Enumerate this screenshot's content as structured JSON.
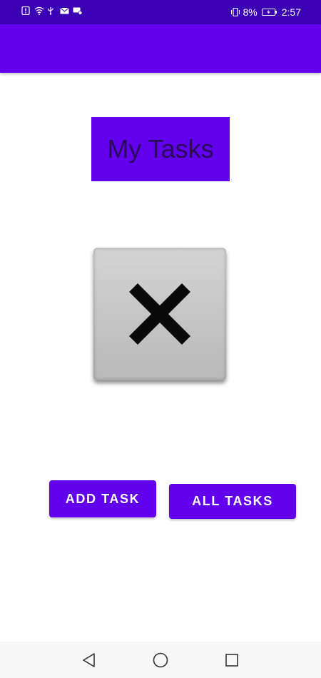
{
  "status_bar": {
    "battery_percent": "8%",
    "time": "2:57",
    "icons": [
      "alert-icon",
      "wifi-icon",
      "usb-icon",
      "mail-icon",
      "message-icon",
      "vibrate-icon",
      "battery-charging-icon"
    ]
  },
  "main": {
    "title": "My Tasks",
    "image_icon": "close-icon"
  },
  "buttons": {
    "add_task": "ADD TASK",
    "all_tasks": "ALL TASKS"
  },
  "nav_bar": {
    "icons": [
      "back-icon",
      "home-icon",
      "recent-apps-icon"
    ]
  },
  "colors": {
    "status_bar": "#3b00b3",
    "primary": "#6200ee",
    "title_text": "#2a0a5a",
    "button_text": "#ffffff"
  }
}
